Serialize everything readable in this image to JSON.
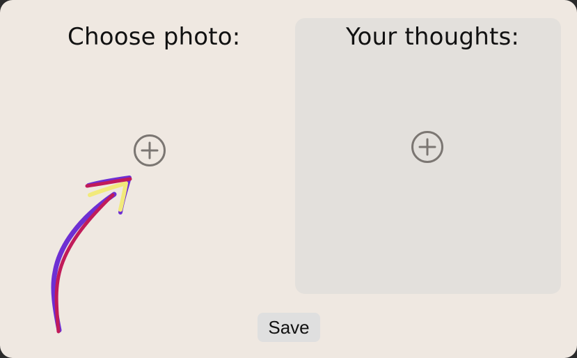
{
  "photo_section": {
    "title": "Choose photo:",
    "add_icon": "plus-circle-icon"
  },
  "thoughts_section": {
    "title": "Your thoughts:",
    "add_icon": "plus-circle-icon"
  },
  "actions": {
    "save_label": "Save"
  },
  "annotation": {
    "icon": "hand-drawn-arrow",
    "colors": [
      "#c11b5a",
      "#6d2fd3",
      "#f2ea7b"
    ]
  }
}
